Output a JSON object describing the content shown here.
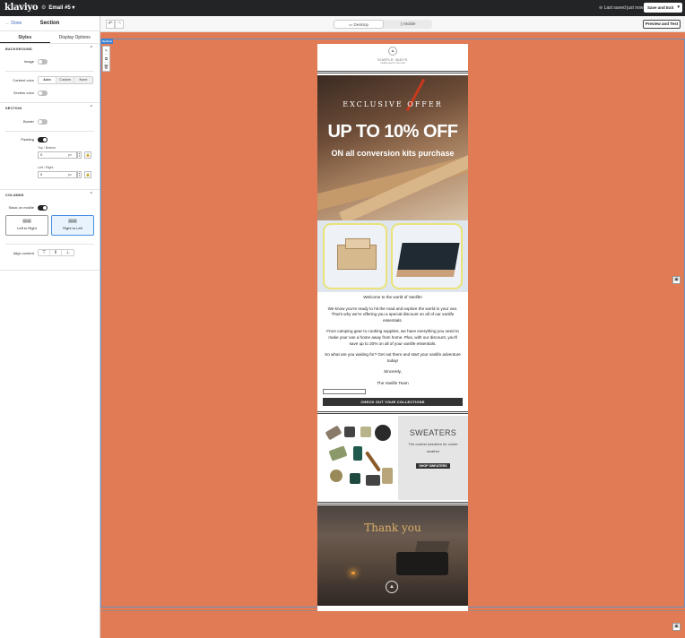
{
  "topbar": {
    "logo": "klaviyo",
    "email_name": "Email #5",
    "saved_status": "Last saved just now",
    "save_exit_label": "Save and Exit"
  },
  "sidebar": {
    "back_label": "← Done",
    "title": "Section",
    "tabs": [
      {
        "label": "Styles",
        "active": true
      },
      {
        "label": "Display Options",
        "active": false
      }
    ],
    "background": {
      "heading": "BACKGROUND",
      "image_label": "Image",
      "content_color_label": "Content color",
      "content_color_options": [
        "Auto",
        "Custom",
        "None"
      ],
      "content_color_selected": "Auto",
      "section_color_label": "Section color"
    },
    "section": {
      "heading": "SECTION",
      "border_label": "Border",
      "padding_label": "Padding",
      "top_bottom_label": "Top / Bottom",
      "top_bottom_value": "0",
      "left_right_label": "Left / Right",
      "left_right_value": "0",
      "unit": "px"
    },
    "columns": {
      "heading": "COLUMNS",
      "stack_label": "Stack on mobile",
      "ltr_label": "Left to Right",
      "rtl_label": "Right to Left",
      "selected": "Right to Left",
      "align_label": "Align content"
    }
  },
  "canvas_bar": {
    "desktop_label": "Desktop",
    "mobile_label": "Mobile",
    "preview_label": "Preview and Test"
  },
  "canvas": {
    "section_tag": "Section",
    "colors": {
      "background": "#e07b55",
      "selection": "#3d83d5"
    }
  },
  "email": {
    "brand": "SIMPLE WAYS",
    "tagline": "vanlife gear for the road",
    "hero": {
      "kicker": "EXCLUSIVE OFFER",
      "headline": "UP TO 10% OFF",
      "subline": "ON all conversion kits purchase"
    },
    "body": [
      "Welcome to the world of Vanlife!",
      "We know you're ready to hit the road and explore the world in your van. That's why we're offering you a special discount on all of our vanlife essentials.",
      "From camping gear to cooking supplies, we have everything you need to make your van a home away from home. Plus, with our discount, you'll save up to 20% on all of your vanlife essentials.",
      "So what are you waiting for? Get out there and start your vanlife adventure today!",
      "Sincerely,",
      "The Vanlife Team"
    ],
    "cta_label": "CHECK OUT YOUR COLLECTIONS",
    "sweaters": {
      "title": "SWEATERS",
      "subtitle": "The coziest sweaters for cooler weather",
      "button": "SHOP SWEATERS"
    },
    "thanks_title": "Thank you"
  }
}
